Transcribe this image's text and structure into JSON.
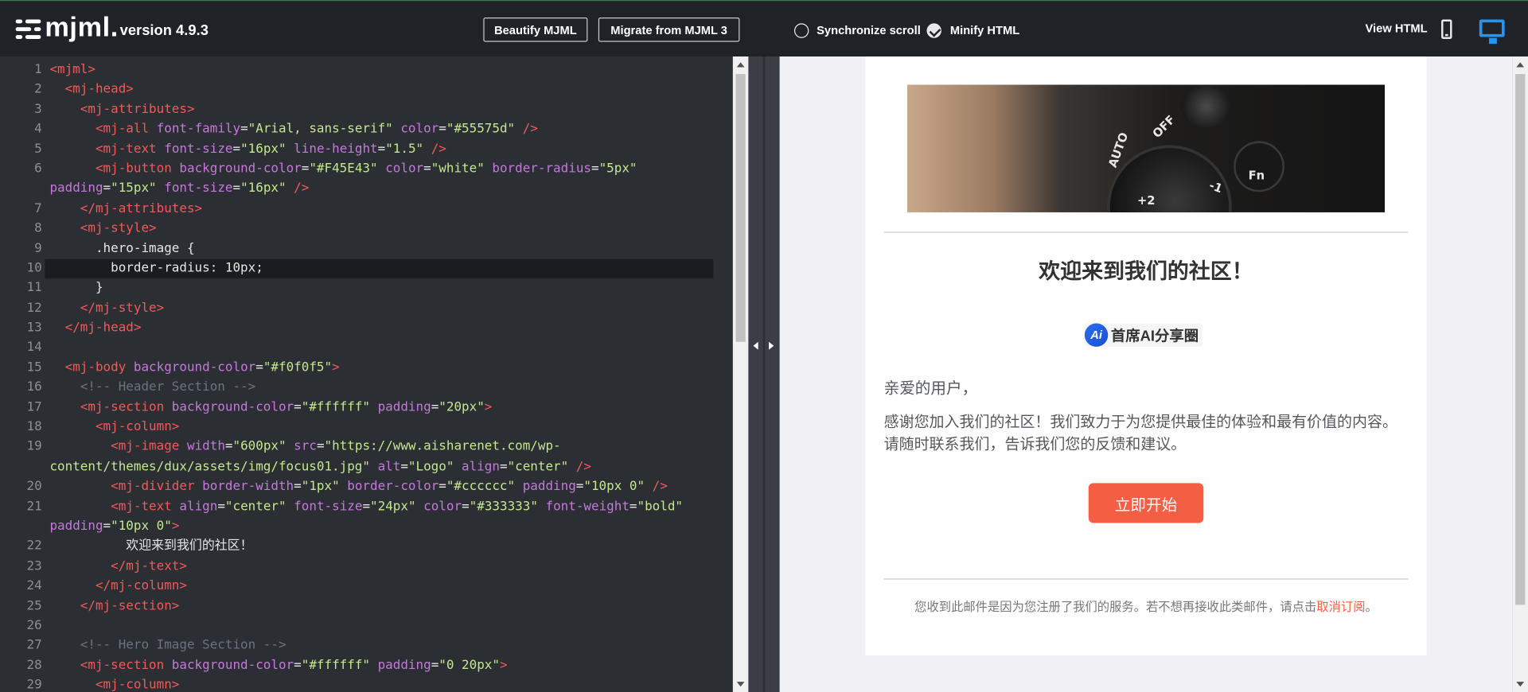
{
  "header": {
    "logo_text": "mjml.",
    "version": "version 4.9.3",
    "beautify_label": "Beautify MJML",
    "migrate_label": "Migrate from MJML 3",
    "sync_scroll_label": "Synchronize scroll",
    "minify_label": "Minify HTML",
    "view_html_label": "View HTML"
  },
  "editor": {
    "active_line": 10,
    "lines": [
      {
        "n": "1",
        "html": "<span class=\"t\">&lt;mjml&gt;</span>"
      },
      {
        "n": "2",
        "html": "  <span class=\"t\">&lt;mj-head&gt;</span>"
      },
      {
        "n": "3",
        "html": "    <span class=\"t\">&lt;mj-attributes&gt;</span>"
      },
      {
        "n": "4",
        "html": "      <span class=\"t\">&lt;mj-all</span> <span class=\"a\">font-family</span>=<span class=\"s\">\"Arial, sans-serif\"</span> <span class=\"a\">color</span>=<span class=\"s\">\"#55575d\"</span> <span class=\"t\">/&gt;</span>"
      },
      {
        "n": "5",
        "html": "      <span class=\"t\">&lt;mj-text</span> <span class=\"a\">font-size</span>=<span class=\"s\">\"16px\"</span> <span class=\"a\">line-height</span>=<span class=\"s\">\"1.5\"</span> <span class=\"t\">/&gt;</span>"
      },
      {
        "n": "6",
        "wrap": true,
        "html": "      <span class=\"t\">&lt;mj-button</span> <span class=\"a\">background-color</span>=<span class=\"s\">\"#F45E43\"</span> <span class=\"a\">color</span>=<span class=\"s\">\"white\"</span> <span class=\"a\">border-radius</span>=<span class=\"s\">\"5px\"</span>\n<span class=\"a\">padding</span>=<span class=\"s\">\"15px\"</span> <span class=\"a\">font-size</span>=<span class=\"s\">\"16px\"</span> <span class=\"t\">/&gt;</span>"
      },
      {
        "n": "7",
        "html": "    <span class=\"t\">&lt;/mj-attributes&gt;</span>"
      },
      {
        "n": "8",
        "html": "    <span class=\"t\">&lt;mj-style&gt;</span>"
      },
      {
        "n": "9",
        "html": "      <span class=\"tx\">.hero-image {</span>"
      },
      {
        "n": "10",
        "html": "        <span class=\"tx\">border-radius: 10px;</span>"
      },
      {
        "n": "11",
        "html": "      <span class=\"tx\">}</span>"
      },
      {
        "n": "12",
        "html": "    <span class=\"t\">&lt;/mj-style&gt;</span>"
      },
      {
        "n": "13",
        "html": "  <span class=\"t\">&lt;/mj-head&gt;</span>"
      },
      {
        "n": "14",
        "html": ""
      },
      {
        "n": "15",
        "html": "  <span class=\"t\">&lt;mj-body</span> <span class=\"a\">background-color</span>=<span class=\"s\">\"#f0f0f5\"</span><span class=\"t\">&gt;</span>"
      },
      {
        "n": "16",
        "html": "    <span class=\"cm\">&lt;!-- Header Section --&gt;</span>"
      },
      {
        "n": "17",
        "html": "    <span class=\"t\">&lt;mj-section</span> <span class=\"a\">background-color</span>=<span class=\"s\">\"#ffffff\"</span> <span class=\"a\">padding</span>=<span class=\"s\">\"20px\"</span><span class=\"t\">&gt;</span>"
      },
      {
        "n": "18",
        "html": "      <span class=\"t\">&lt;mj-column&gt;</span>"
      },
      {
        "n": "19",
        "wrap": true,
        "html": "        <span class=\"t\">&lt;mj-image</span> <span class=\"a\">width</span>=<span class=\"s\">\"600px\"</span> <span class=\"a\">src</span>=<span class=\"s\">\"https://www.aisharenet.com/wp-</span>\n<span class=\"s\">content/themes/dux/assets/img/focus01.jpg\"</span> <span class=\"a\">alt</span>=<span class=\"s\">\"Logo\"</span> <span class=\"a\">align</span>=<span class=\"s\">\"center\"</span> <span class=\"t\">/&gt;</span>"
      },
      {
        "n": "20",
        "html": "        <span class=\"t\">&lt;mj-divider</span> <span class=\"a\">border-width</span>=<span class=\"s\">\"1px\"</span> <span class=\"a\">border-color</span>=<span class=\"s\">\"#cccccc\"</span> <span class=\"a\">padding</span>=<span class=\"s\">\"10px 0\"</span> <span class=\"t\">/&gt;</span>"
      },
      {
        "n": "21",
        "wrap": true,
        "html": "        <span class=\"t\">&lt;mj-text</span> <span class=\"a\">align</span>=<span class=\"s\">\"center\"</span> <span class=\"a\">font-size</span>=<span class=\"s\">\"24px\"</span> <span class=\"a\">color</span>=<span class=\"s\">\"#333333\"</span> <span class=\"a\">font-weight</span>=<span class=\"s\">\"bold\"</span>\n<span class=\"a\">padding</span>=<span class=\"s\">\"10px 0\"</span><span class=\"t\">&gt;</span>"
      },
      {
        "n": "22",
        "html": "          <span class=\"tx\">欢迎来到我们的社区！</span>"
      },
      {
        "n": "23",
        "html": "        <span class=\"t\">&lt;/mj-text&gt;</span>"
      },
      {
        "n": "24",
        "html": "      <span class=\"t\">&lt;/mj-column&gt;</span>"
      },
      {
        "n": "25",
        "html": "    <span class=\"t\">&lt;/mj-section&gt;</span>"
      },
      {
        "n": "26",
        "html": ""
      },
      {
        "n": "27",
        "html": "    <span class=\"cm\">&lt;!-- Hero Image Section --&gt;</span>"
      },
      {
        "n": "28",
        "html": "    <span class=\"t\">&lt;mj-section</span> <span class=\"a\">background-color</span>=<span class=\"s\">\"#ffffff\"</span> <span class=\"a\">padding</span>=<span class=\"s\">\"0 20px\"</span><span class=\"t\">&gt;</span>"
      },
      {
        "n": "29",
        "html": "      <span class=\"t\">&lt;mj-column&gt;</span>"
      }
    ]
  },
  "preview": {
    "hero_alt": "Logo",
    "welcome_title": "欢迎来到我们的社区！",
    "brand_icon": "Ai",
    "brand_name": "首席AI分享圈",
    "greeting": "亲爱的用户，",
    "body_text": "感谢您加入我们的社区！我们致力于为您提供最佳的体验和最有价值的内容。请随时联系我们，告诉我们您的反馈和建议。",
    "cta_label": "立即开始",
    "footer_text": "您收到此邮件是因为您注册了我们的服务。若不想再接收此类邮件，请点击",
    "footer_link": "取消订阅",
    "footer_end": "。",
    "cta_color": "#f45e43",
    "background_color": "#f0f0f5"
  },
  "icons": {
    "logo": "mjml-logo-icon",
    "mobile": "mobile-icon",
    "desktop": "desktop-icon"
  }
}
